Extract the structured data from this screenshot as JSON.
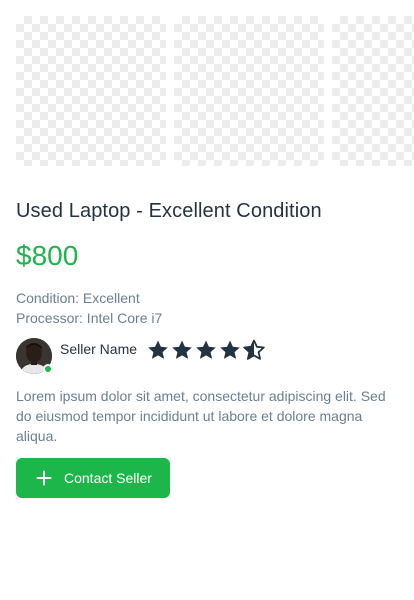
{
  "listing": {
    "title": "Used Laptop - Excellent Condition",
    "price": "$800",
    "condition": "Condition: Excellent",
    "processor": "Processor: Intel Core i7",
    "description": "Lorem ipsum dolor sit amet, consectetur adipiscing elit. Sed do eiusmod tempor incididunt ut labore et dolore magna aliqua."
  },
  "gallery": {
    "images": [
      "image-placeholder",
      "image-placeholder",
      "image-placeholder"
    ]
  },
  "seller": {
    "name": "Seller Name",
    "online": true,
    "rating": 4.5,
    "rating_max": 5
  },
  "actions": {
    "contact_label": "Contact Seller"
  },
  "colors": {
    "accent": "#1db64a",
    "title": "#243342",
    "muted": "#6b7f94",
    "star": "#243342"
  }
}
